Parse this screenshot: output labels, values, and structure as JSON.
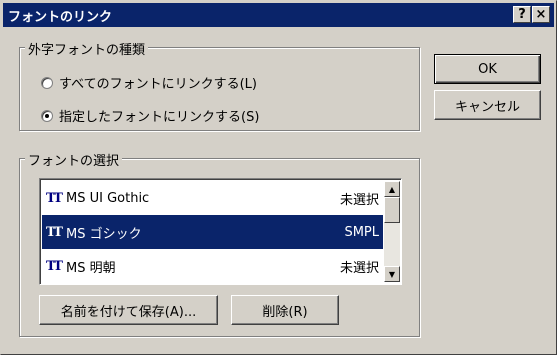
{
  "window": {
    "title": "フォントのリンク",
    "help_button": "?",
    "close_button": "×"
  },
  "type_group": {
    "label": "外字フォントの種類",
    "options": [
      {
        "label": "すべてのフォントにリンクする(L)",
        "checked": false
      },
      {
        "label": "指定したフォントにリンクする(S)",
        "checked": true
      }
    ]
  },
  "buttons": {
    "ok": "OK",
    "cancel": "キャンセル",
    "save_as": "名前を付けて保存(A)...",
    "delete": "削除(R)"
  },
  "font_group": {
    "label": "フォントの選択",
    "fonts": [
      {
        "name": "MS UI Gothic",
        "status": "未選択",
        "selected": false
      },
      {
        "name": "MS ゴシック",
        "status": "SMPL",
        "selected": true
      },
      {
        "name": "MS 明朝",
        "status": "未選択",
        "selected": false
      }
    ]
  },
  "icons": {
    "font_type": "truetype-icon",
    "scroll_up": "▲",
    "scroll_down": "▼",
    "truetype_glyph": "TT"
  },
  "colors": {
    "titlebar": "#0a246a",
    "face": "#d4d0c8",
    "selection": "#0a246a"
  }
}
